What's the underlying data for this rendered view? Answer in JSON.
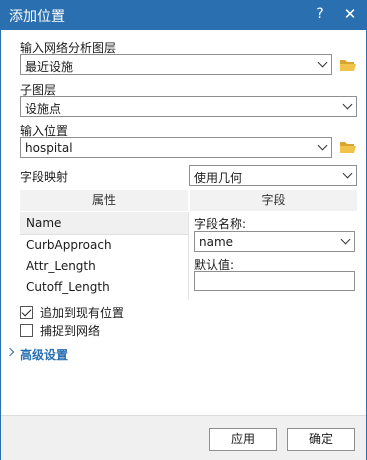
{
  "dialog": {
    "title": "添加位置",
    "help": "?",
    "close": "✕"
  },
  "network_layer": {
    "label": "输入网络分析图层",
    "value": "最近设施"
  },
  "sublayer": {
    "label": "子图层",
    "value": "设施点"
  },
  "input_location": {
    "label": "输入位置",
    "value": "hospital"
  },
  "field_mapping": {
    "label": "字段映射",
    "mode_value": "使用几何",
    "col_property": "属性",
    "col_field": "字段",
    "list_header": "Name",
    "properties": [
      "CurbApproach",
      "Attr_Length",
      "Cutoff_Length"
    ],
    "field_name_label": "字段名称:",
    "field_name_value": "name",
    "default_label": "默认值:",
    "default_value": ""
  },
  "options": {
    "append_label": "追加到现有位置",
    "append_checked": true,
    "snap_label": "捕捉到网络",
    "snap_checked": false
  },
  "advanced": {
    "label": "高级设置"
  },
  "buttons": {
    "apply": "应用",
    "ok": "确定"
  },
  "icons": {
    "folder": "folder-open-icon",
    "chevron": "chevron-down-icon"
  },
  "colors": {
    "accent": "#2a6fb0",
    "folder": "#e8b73a"
  }
}
